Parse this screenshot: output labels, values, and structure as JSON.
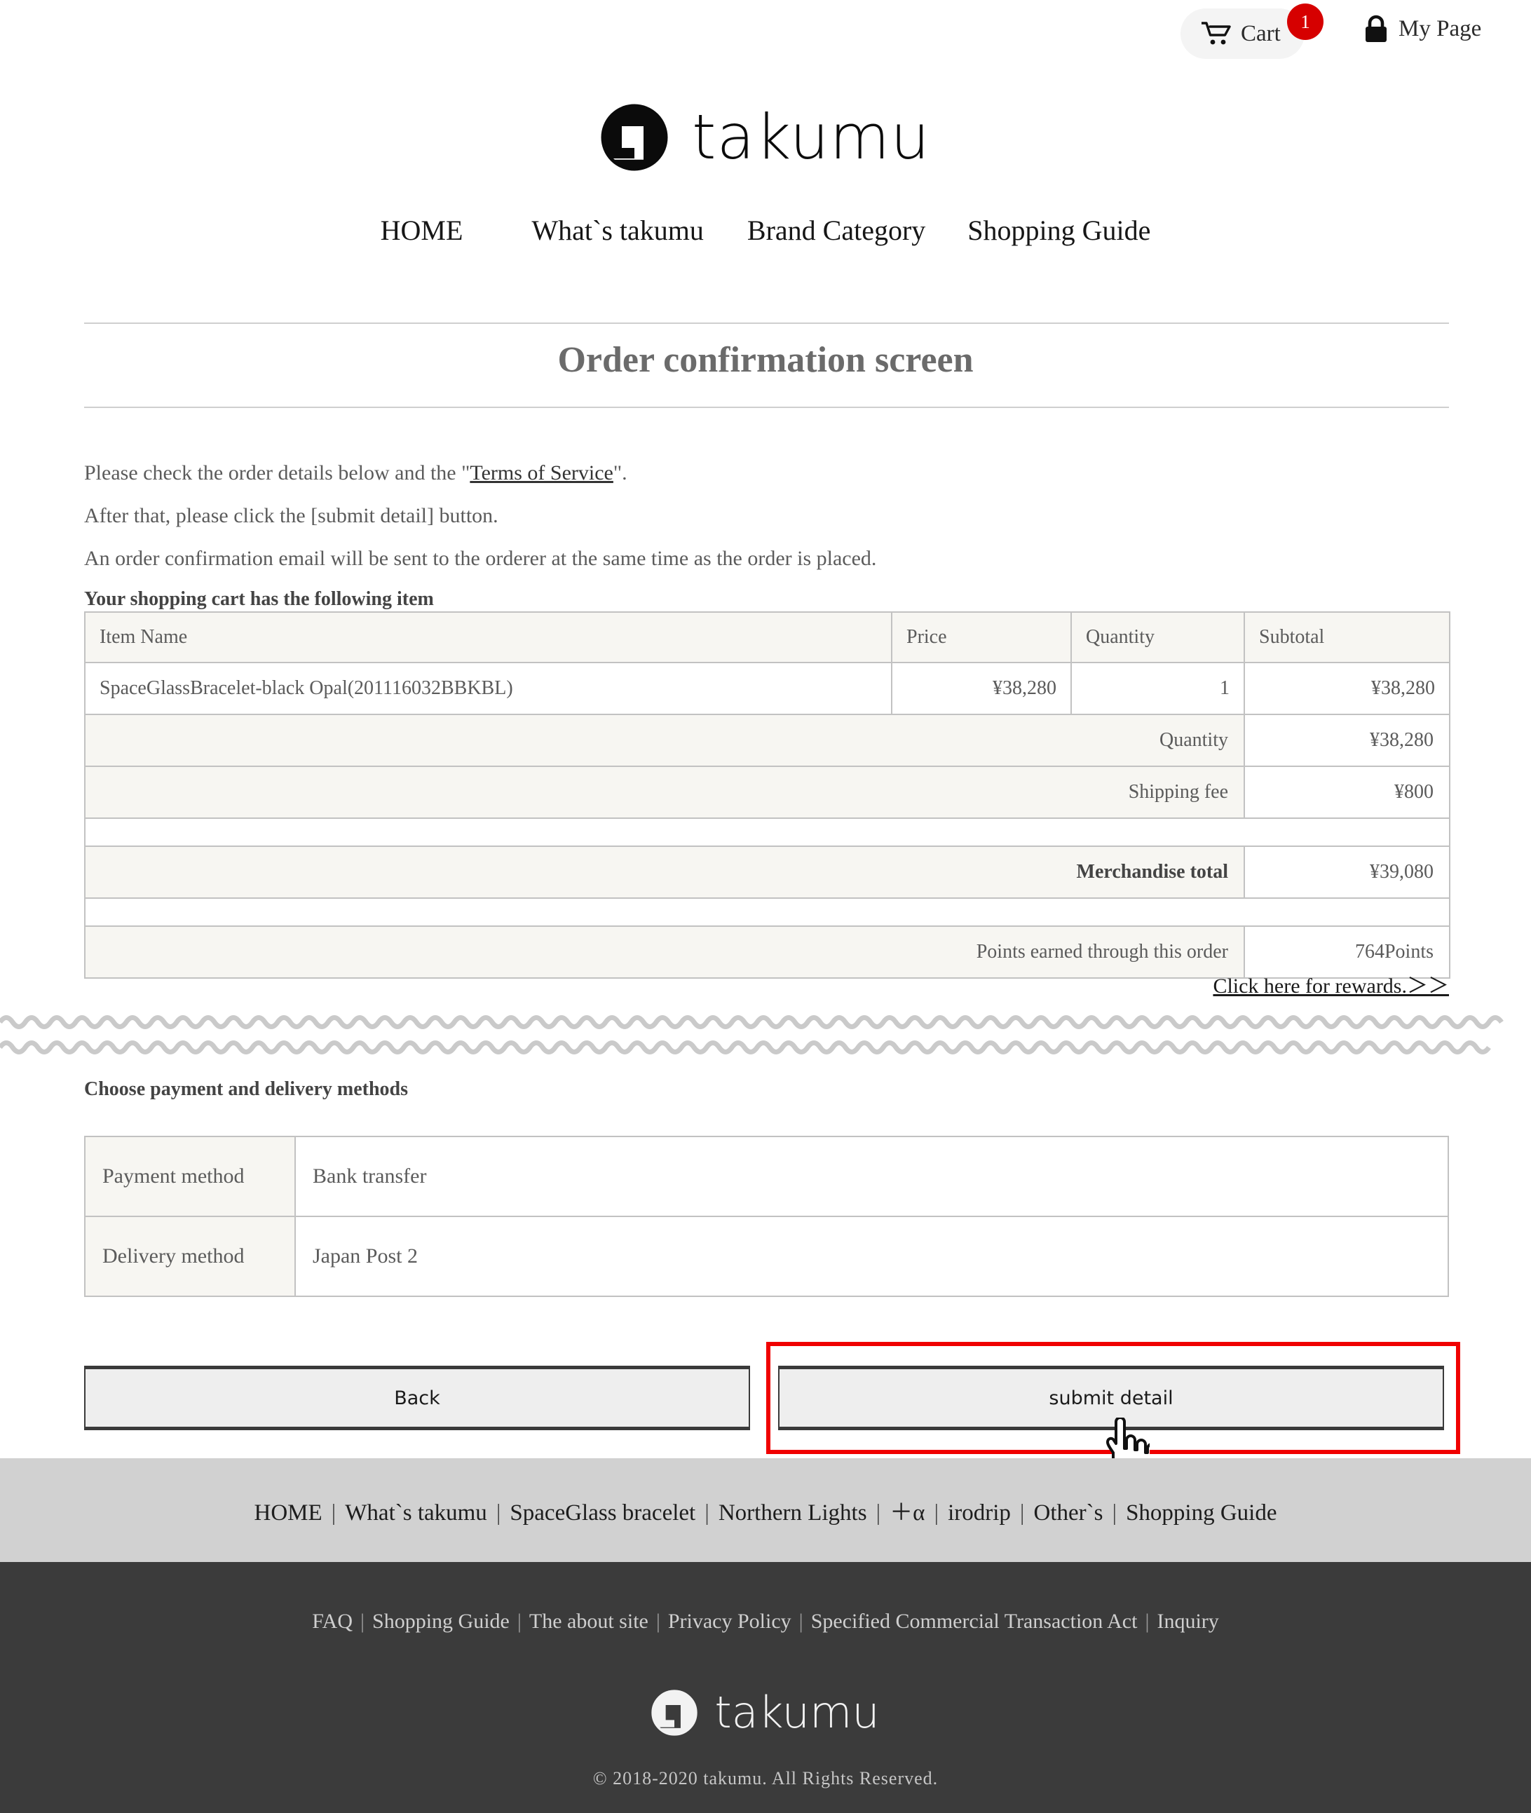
{
  "topbar": {
    "cart_label": "Cart",
    "cart_badge": "1",
    "cart_icon": "shopping-cart-icon",
    "mypage_label": "My Page",
    "mypage_icon": "lock-icon"
  },
  "brand": {
    "name": "takumu",
    "logo_icon": "takumu-logo-mark"
  },
  "mainnav": {
    "items": [
      {
        "label": "HOME"
      },
      {
        "label": "What`s takumu"
      },
      {
        "label": "Brand Category"
      },
      {
        "label": "Shopping Guide"
      }
    ]
  },
  "page": {
    "title": "Order confirmation screen"
  },
  "intro": {
    "line1_pre": "Please check the order details below and the \"",
    "line1_link": "Terms of Service",
    "line1_post": "\".",
    "line2": "After that, please click the [submit detail] button.",
    "line3": "An order confirmation email will be sent to the orderer at the same time as the order is placed.",
    "cart_heading": "Your shopping cart has the following item"
  },
  "order_table": {
    "headers": {
      "item": "Item Name",
      "price": "Price",
      "quantity": "Quantity",
      "subtotal": "Subtotal"
    },
    "rows": [
      {
        "item": "SpaceGlassBracelet-black Opal(201116032BBKBL)",
        "price": "¥38,280",
        "quantity": "1",
        "subtotal": "¥38,280"
      }
    ],
    "summary": {
      "quantity_label": "Quantity",
      "quantity_value": "¥38,280",
      "shipping_label": "Shipping fee",
      "shipping_value": "¥800",
      "merch_total_label": "Merchandise total",
      "merch_total_value": "¥39,080",
      "points_label": "Points earned through this order",
      "points_value": "764Points"
    },
    "rewards_link": "Click here for rewards.＞＞"
  },
  "payment_delivery": {
    "heading": "Choose payment and delivery methods",
    "rows": [
      {
        "key": "Payment method",
        "value": "Bank transfer"
      },
      {
        "key": "Delivery method",
        "value": "Japan Post 2"
      }
    ]
  },
  "actions": {
    "back_label": "Back",
    "submit_label": "submit detail",
    "highlight_color": "#f00000",
    "cursor_icon": "pointing-hand-cursor"
  },
  "footer_nav": {
    "items": [
      {
        "label": "HOME"
      },
      {
        "label": "What`s takumu"
      },
      {
        "label": "SpaceGlass bracelet"
      },
      {
        "label": "Northern Lights"
      },
      {
        "label": "＋α"
      },
      {
        "label": "irodrip"
      },
      {
        "label": "Other`s"
      },
      {
        "label": "Shopping Guide"
      }
    ],
    "separator": "|"
  },
  "footer": {
    "links": [
      {
        "label": "FAQ"
      },
      {
        "label": "Shopping Guide"
      },
      {
        "label": "The about site"
      },
      {
        "label": "Privacy Policy"
      },
      {
        "label": "Specified Commercial Transaction Act"
      },
      {
        "label": "Inquiry"
      }
    ],
    "separator": "|",
    "logo_text": "takumu",
    "logo_icon": "takumu-logo-mark",
    "copyright": "© 2018-2020 takumu. All Rights Reserved."
  }
}
